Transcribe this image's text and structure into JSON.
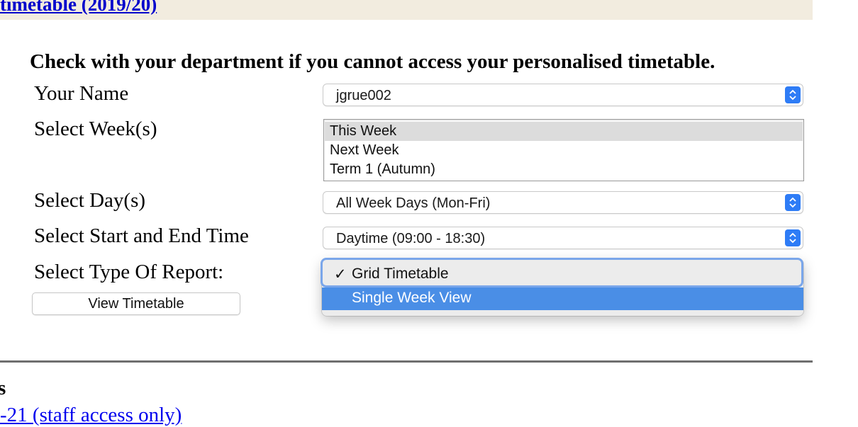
{
  "header": {
    "link_text": "timetable (2019/20)"
  },
  "form": {
    "heading": "Check with your department if you cannot access your personalised timetable.",
    "name_label": "Your Name",
    "name_value": "jgrue002",
    "weeks_label": "Select Week(s)",
    "weeks_options": [
      "This Week",
      "Next Week",
      "Term 1 (Autumn)"
    ],
    "weeks_selected": "This Week",
    "days_label": "Select Day(s)",
    "days_value": "All Week Days (Mon-Fri)",
    "time_label": "Select Start and End Time",
    "time_value": "Daytime (09:00 - 18:30)",
    "report_label": "Select Type Of Report:",
    "report_menu": {
      "checked": "Grid Timetable",
      "highlighted": "Single Week View",
      "check_glyph": "✓"
    },
    "view_button": "View Timetable"
  },
  "footer": {
    "fragment_heading": "s",
    "fragment_link": "-21 (staff access only)"
  },
  "colors": {
    "link": "#0000ee",
    "header_bg": "#f2ecdf",
    "accent": "#2e7cf6",
    "menu_highlight": "#4a8ee6"
  },
  "icons": {
    "select_arrows": "chevron-up-down-icon",
    "checkmark": "checkmark-icon"
  }
}
